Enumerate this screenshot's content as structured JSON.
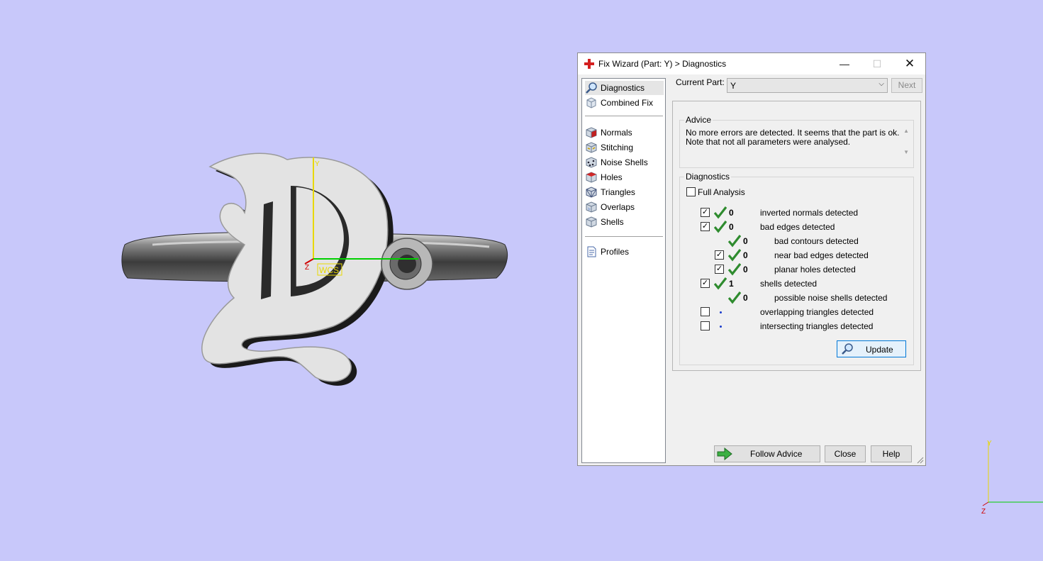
{
  "viewport": {
    "wcs_label": "WCS",
    "axis_y_label": "Y",
    "axis_z_label": "Z",
    "corner_axis_y_label": "Y",
    "corner_axis_z_label": "Z"
  },
  "dialog": {
    "title": "Fix Wizard (Part: Y) > Diagnostics",
    "window_controls": {
      "minimize": "—",
      "maximize": "☐",
      "close": "✕"
    }
  },
  "nav": {
    "items": [
      {
        "label": "Diagnostics",
        "icon": "magnifier-icon",
        "selected": true
      },
      {
        "label": "Combined Fix",
        "icon": "combined-fix-icon"
      },
      {
        "label": "Normals",
        "icon": "normals-cube-icon"
      },
      {
        "label": "Stitching",
        "icon": "stitching-cube-icon"
      },
      {
        "label": "Noise Shells",
        "icon": "noise-shells-cube-icon"
      },
      {
        "label": "Holes",
        "icon": "holes-cube-icon"
      },
      {
        "label": "Triangles",
        "icon": "triangles-cube-icon"
      },
      {
        "label": "Overlaps",
        "icon": "overlaps-cube-icon"
      },
      {
        "label": "Shells",
        "icon": "shells-cube-icon"
      },
      {
        "label": "Profiles",
        "icon": "profiles-document-icon"
      }
    ]
  },
  "current_part": {
    "label": "Current Part:",
    "value": "Y",
    "next_label": "Next"
  },
  "advice": {
    "title": "Advice",
    "line1": "No more errors are detected. It seems that the part is ok.",
    "line2": "Note that not all parameters were analysed."
  },
  "diagnostics": {
    "title": "Diagnostics",
    "full_analysis_label": "Full Analysis",
    "full_analysis_checked": false,
    "rows": [
      {
        "checkbox": true,
        "checked": true,
        "status": "ok",
        "count": "0",
        "label": "inverted normals detected",
        "indent": 0
      },
      {
        "checkbox": true,
        "checked": true,
        "status": "ok",
        "count": "0",
        "label": "bad edges detected",
        "indent": 0
      },
      {
        "checkbox": false,
        "status": "ok",
        "count": "0",
        "label": "bad contours detected",
        "indent": 1
      },
      {
        "checkbox": true,
        "checked": true,
        "status": "ok",
        "count": "0",
        "label": "near bad edges detected",
        "indent": 1
      },
      {
        "checkbox": true,
        "checked": true,
        "status": "ok",
        "count": "0",
        "label": "planar holes detected",
        "indent": 1
      },
      {
        "checkbox": true,
        "checked": true,
        "status": "ok",
        "count": "1",
        "label": "shells detected",
        "indent": 0
      },
      {
        "checkbox": false,
        "status": "ok",
        "count": "0",
        "label": "possible noise shells detected",
        "indent": 1
      },
      {
        "checkbox": true,
        "checked": false,
        "status": "pending",
        "count": "",
        "label": "overlapping triangles detected",
        "indent": 0
      },
      {
        "checkbox": true,
        "checked": false,
        "status": "pending",
        "count": "",
        "label": "intersecting triangles detected",
        "indent": 0
      }
    ],
    "update_label": "Update"
  },
  "footer": {
    "follow_advice_label": "Follow Advice",
    "close_label": "Close",
    "help_label": "Help"
  },
  "colors": {
    "background": "#c8c8fa",
    "accent_blue": "#0078d7",
    "ok_green": "#2e8b2e",
    "axis_yellow": "#e8d800",
    "axis_green": "#00d000"
  }
}
